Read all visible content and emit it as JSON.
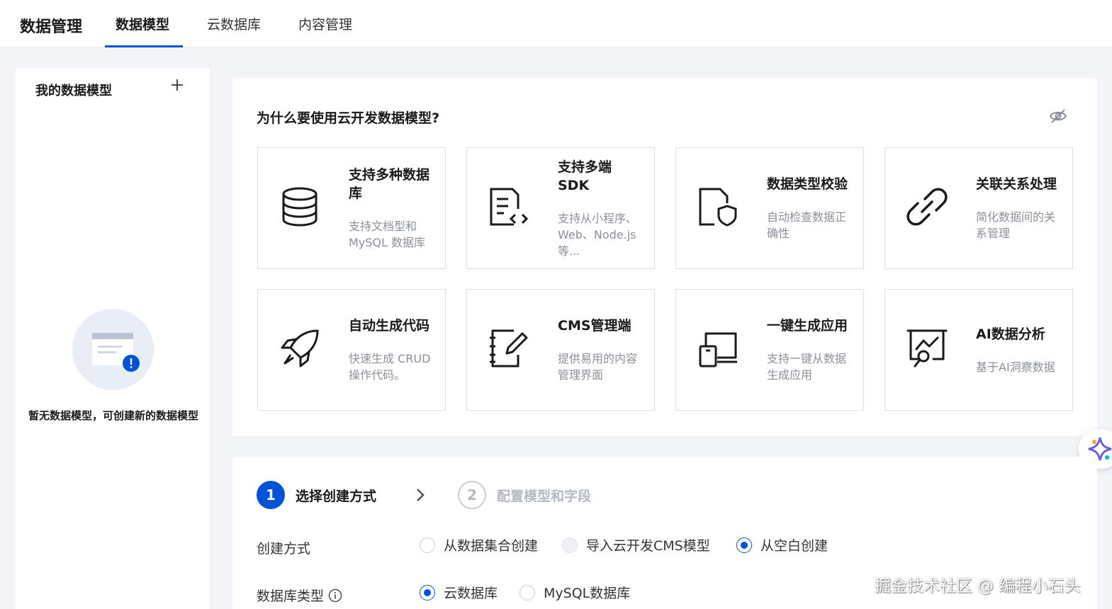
{
  "header": {
    "brand": "数据管理",
    "tabs": [
      {
        "label": "数据模型",
        "active": true
      },
      {
        "label": "云数据库",
        "active": false
      },
      {
        "label": "内容管理",
        "active": false
      }
    ]
  },
  "sidebar": {
    "title": "我的数据模型",
    "add_icon": "plus-icon",
    "empty_text": "暂无数据模型，可创建新的数据模型"
  },
  "panel": {
    "title": "为什么要使用云开发数据模型?",
    "hide_icon": "eye-off-icon",
    "cards": [
      {
        "title": "支持多种数据库",
        "desc": "支持文档型和 MySQL 数据库",
        "icon": "database-icon"
      },
      {
        "title": "支持多端 SDK",
        "desc": "支持从小程序、Web、Node.js 等...",
        "icon": "code-document-icon"
      },
      {
        "title": "数据类型校验",
        "desc": "自动检查数据正确性",
        "icon": "shield-document-icon"
      },
      {
        "title": "关联关系处理",
        "desc": "简化数据间的关系管理",
        "icon": "link-icon"
      },
      {
        "title": "自动生成代码",
        "desc": "快速生成 CRUD 操作代码。",
        "icon": "rocket-icon"
      },
      {
        "title": "CMS管理端",
        "desc": "提供易用的内容管理界面",
        "icon": "notebook-edit-icon"
      },
      {
        "title": "一键生成应用",
        "desc": "支持一键从数据生成应用",
        "icon": "devices-icon"
      },
      {
        "title": "AI数据分析",
        "desc": "基于AI洞察数据",
        "icon": "chart-search-icon"
      }
    ]
  },
  "form": {
    "steps": [
      {
        "number": "1",
        "label": "选择创建方式",
        "active": true
      },
      {
        "number": "2",
        "label": "配置模型和字段",
        "active": false
      }
    ],
    "create_method": {
      "label": "创建方式",
      "options": [
        {
          "label": "从数据集合创建",
          "checked": false,
          "disabled": false
        },
        {
          "label": "导入云开发CMS模型",
          "checked": false,
          "disabled": true
        },
        {
          "label": "从空白创建",
          "checked": true,
          "disabled": false
        }
      ]
    },
    "db_type": {
      "label": "数据库类型",
      "options": [
        {
          "label": "云数据库",
          "checked": true
        },
        {
          "label": "MySQL数据库",
          "checked": false
        }
      ]
    }
  },
  "watermark": "掘金技术社区 @ 编程小石头",
  "colors": {
    "accent": "#0052d9",
    "muted": "#8a8f99",
    "background": "#f3f4f7"
  }
}
